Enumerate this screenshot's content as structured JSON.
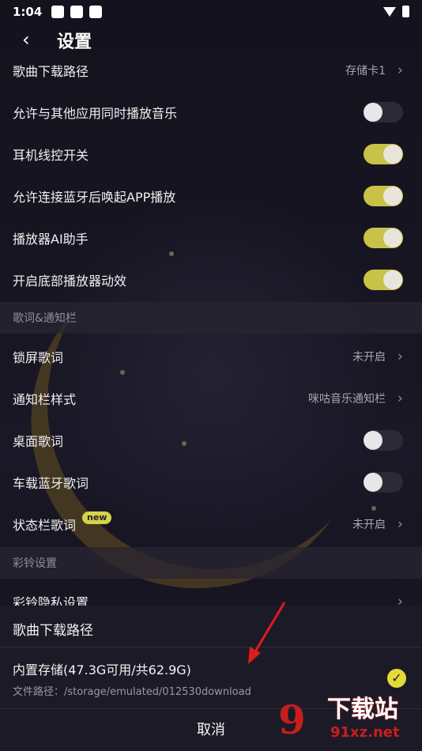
{
  "status_bar": {
    "time": "1:04"
  },
  "header": {
    "title": "设置"
  },
  "rows": [
    {
      "label": "歌曲下载路径",
      "value": "存储卡1"
    },
    {
      "label": "允许与其他应用同时播放音乐",
      "toggle": "off"
    },
    {
      "label": "耳机线控开关",
      "toggle": "on"
    },
    {
      "label": "允许连接蓝牙后唤起APP播放",
      "toggle": "on"
    },
    {
      "label": "播放器AI助手",
      "toggle": "on"
    },
    {
      "label": "开启底部播放器动效",
      "toggle": "on"
    }
  ],
  "section_lyrics": {
    "label": "歌词&通知栏"
  },
  "lyrics_rows": [
    {
      "label": "锁屏歌词",
      "value": "未开启"
    },
    {
      "label": "通知栏样式",
      "value": "咪咕音乐通知栏"
    },
    {
      "label": "桌面歌词",
      "toggle": "off"
    },
    {
      "label": "车载蓝牙歌词",
      "toggle": "off"
    },
    {
      "label": "状态栏歌词",
      "badge": "new",
      "value": "未开启"
    }
  ],
  "section_ringtone": {
    "label": "彩铃设置"
  },
  "ringtone_rows": [
    {
      "label": "彩铃隐私设置"
    }
  ],
  "sheet": {
    "title": "歌曲下载路径",
    "option_title": "内置存储(47.3G可用/共62.9G)",
    "option_path": "文件路径：/storage/emulated/012530download",
    "cancel": "取消"
  },
  "watermark": {
    "logo_number": "9",
    "text": "下载站",
    "url": "91xz.net"
  },
  "colors": {
    "toggle_on": "#c9c248",
    "check": "#e2da38",
    "background": "#151320",
    "watermark_red": "#c81e1e"
  }
}
